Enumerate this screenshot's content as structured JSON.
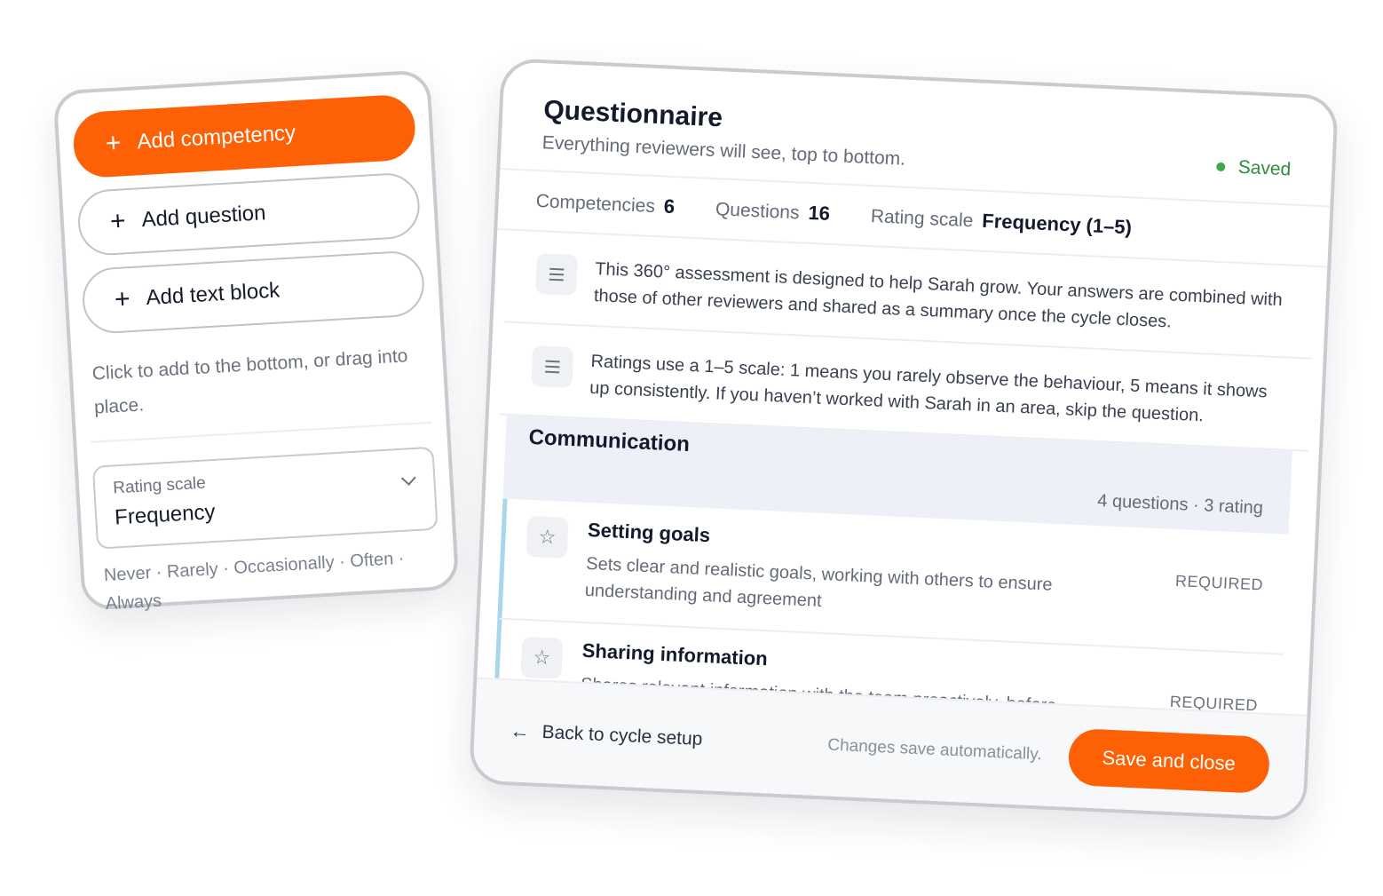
{
  "toolbox": {
    "add_competency": "Add competency",
    "add_question": "Add question",
    "add_text_block": "Add text block",
    "plus_glyph": "+",
    "hint": "Click to add to the bottom, or drag into place.",
    "rating_scale": {
      "label": "Rating scale",
      "value": "Frequency",
      "levels": "Never · Rarely · Occasionally · Often · Always"
    }
  },
  "panel": {
    "title": "Questionnaire",
    "subtitle": "Everything reviewers will see, top to bottom.",
    "status": "Saved",
    "stats": [
      {
        "label": "Competencies",
        "value": "6"
      },
      {
        "label": "Questions",
        "value": "16"
      },
      {
        "label": "Rating scale",
        "value": "Frequency (1–5)"
      }
    ],
    "text_blocks": [
      "This 360° assessment is designed to help Sarah grow. Your answers are combined with those of other reviewers and shared as a summary once the cycle closes.",
      "Ratings use a 1–5 scale: 1 means you rarely observe the behaviour, 5 means it shows up consistently. If you haven’t worked with Sarah in an area, skip the question."
    ],
    "section": {
      "title": "Communication",
      "meta": "4 questions · 3 rating"
    },
    "questions": [
      {
        "title": "Setting goals",
        "description": "Sets clear and realistic goals, working with others to ensure understanding and agreement",
        "tag": "REQUIRED"
      },
      {
        "title": "Sharing information",
        "description": "Shares relevant information with the team proactively, before being asked",
        "tag": "REQUIRED"
      }
    ],
    "footer": {
      "back": "Back to cycle setup",
      "autosave": "Changes save automatically.",
      "save": "Save and close"
    }
  },
  "colors": {
    "accent": "#fe6006",
    "saved": "#2f8f3a",
    "question_rail": "#a9d6ea",
    "section_bg": "#eef0f7"
  },
  "icons": [
    "plus-icon",
    "text-block-icon",
    "star-icon",
    "chevron-down-icon",
    "arrow-left-icon",
    "status-dot-icon"
  ]
}
